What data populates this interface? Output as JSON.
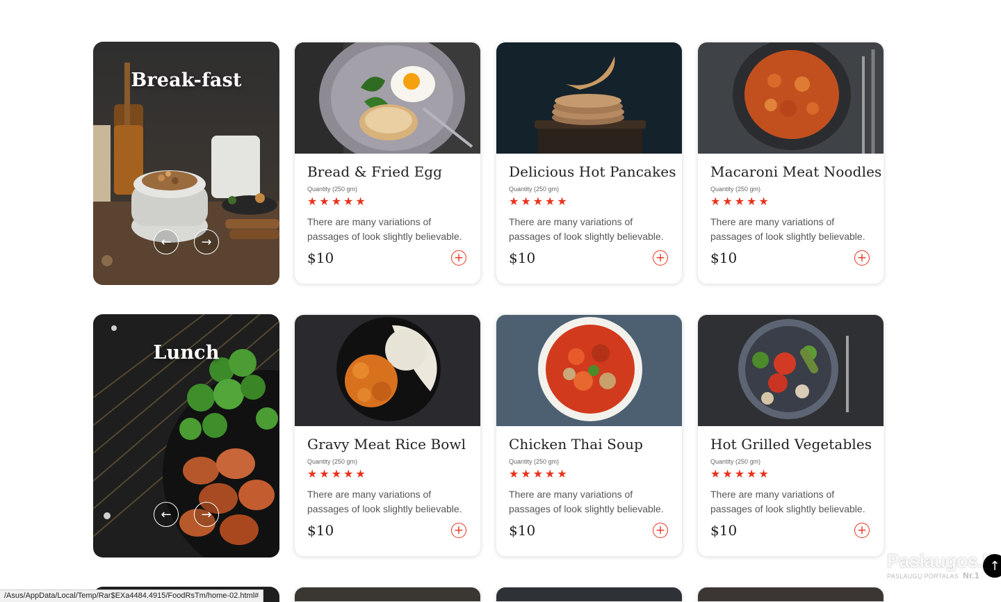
{
  "categories": [
    {
      "title": "Break-fast"
    },
    {
      "title": "Lunch"
    }
  ],
  "nav": {
    "prev_icon": "←",
    "next_icon": "→"
  },
  "rows": [
    [
      {
        "name": "Bread & Fried Egg",
        "quantity": "Quantity (250 gm)",
        "stars": "★★★★★",
        "description": "There are many variations of passages of look slightly believable.",
        "price": "$10",
        "add": "+"
      },
      {
        "name": "Delicious Hot Pancakes",
        "quantity": "Quantity (250 gm)",
        "stars": "★★★★★",
        "description": "There are many variations of passages of look slightly believable.",
        "price": "$10",
        "add": "+"
      },
      {
        "name": "Macaroni Meat Noodles",
        "quantity": "Quantity (250 gm)",
        "stars": "★★★★★",
        "description": "There are many variations of passages of look slightly believable.",
        "price": "$10",
        "add": "+"
      }
    ],
    [
      {
        "name": "Gravy Meat Rice Bowl",
        "quantity": "Quantity (250 gm)",
        "stars": "★★★★★",
        "description": "There are many variations of passages of look slightly believable.",
        "price": "$10",
        "add": "+"
      },
      {
        "name": "Chicken Thai Soup",
        "quantity": "Quantity (250 gm)",
        "stars": "★★★★★",
        "description": "There are many variations of passages of look slightly believable.",
        "price": "$10",
        "add": "+"
      },
      {
        "name": "Hot Grilled Vegetables",
        "quantity": "Quantity (250 gm)",
        "stars": "★★★★★",
        "description": "There are many variations of passages of look slightly believable.",
        "price": "$10",
        "add": "+"
      }
    ]
  ],
  "status_url": "/Asus/AppData/Local/Temp/Rar$EXa4484.4915/FoodRsTm/home-02.html#",
  "scroll_top_icon": "↑",
  "watermark": {
    "main": "Paslaugos.lt",
    "sub": "PASLAUGŲ PORTALAS",
    "rank": "Nr.1"
  },
  "colors": {
    "accent": "#e8331c",
    "text": "#1f1f1f"
  }
}
